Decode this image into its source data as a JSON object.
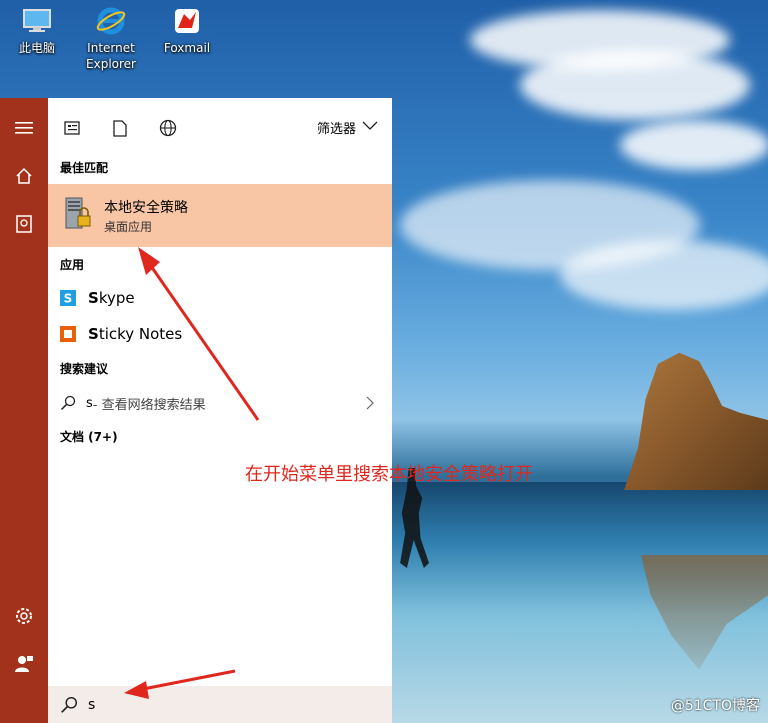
{
  "desktop": {
    "icons": [
      {
        "label": "此电脑",
        "icon": "computer-icon"
      },
      {
        "label": "Internet\nExplorer",
        "icon": "internet-explorer-icon"
      },
      {
        "label": "Foxmail",
        "icon": "foxmail-icon"
      }
    ]
  },
  "start_menu": {
    "rail": {
      "hamburger": "hamburger-icon",
      "home": "home-icon",
      "recent": "recent-icon",
      "settings": "gear-icon",
      "user": "user-icon"
    },
    "toolbar": {
      "filter_label": "筛选器"
    },
    "best_match": {
      "section_label": "最佳匹配",
      "name": "本地安全策略",
      "subtitle": "桌面应用"
    },
    "apps": {
      "section_label": "应用",
      "items": [
        {
          "bold": "S",
          "rest": "kype",
          "color": "#1e9ee3"
        },
        {
          "bold": "S",
          "rest": "ticky Notes",
          "color": "#e8610a"
        }
      ]
    },
    "suggestions": {
      "section_label": "搜索建议",
      "query": "s",
      "text": " - 查看网络搜索结果"
    },
    "documents": {
      "section_label": "文档 (7+)"
    },
    "search": {
      "value": "s"
    }
  },
  "annotation": {
    "text": "在开始菜单里搜索本地安全策略打开",
    "color": "#e0271e"
  },
  "watermark": {
    "text": "@51CTO博客"
  }
}
